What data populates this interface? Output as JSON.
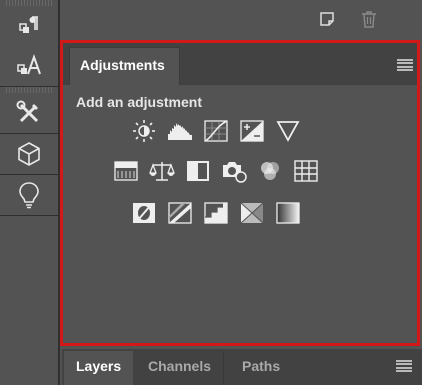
{
  "adjustments_panel": {
    "tab_label": "Adjustments",
    "heading": "Add an adjustment",
    "rows": [
      [
        "brightness-contrast-icon",
        "levels-icon",
        "curves-icon",
        "exposure-icon",
        "vibrance-icon"
      ],
      [
        "hue-saturation-icon",
        "color-balance-icon",
        "black-white-icon",
        "photo-filter-icon",
        "channel-mixer-icon",
        "color-lookup-icon"
      ],
      [
        "invert-icon",
        "posterize-icon",
        "threshold-icon",
        "selective-color-icon",
        "gradient-map-icon"
      ]
    ]
  },
  "layers_panel": {
    "tabs": [
      {
        "label": "Layers",
        "active": true
      },
      {
        "label": "Channels",
        "active": false
      },
      {
        "label": "Paths",
        "active": false
      }
    ]
  },
  "toolstrip_icons": [
    "paragraph-icon",
    "character-icon",
    "tools-icon",
    "3d-cube-icon",
    "lightbulb-icon"
  ],
  "topbar_icons": [
    "new-layer-icon",
    "trash-icon"
  ],
  "colors": {
    "panel_bg": "#535353",
    "tabbar_bg": "#424242",
    "highlight_border": "#d21818",
    "text_active": "#ffffff",
    "text_inactive": "#a9a9a9"
  }
}
